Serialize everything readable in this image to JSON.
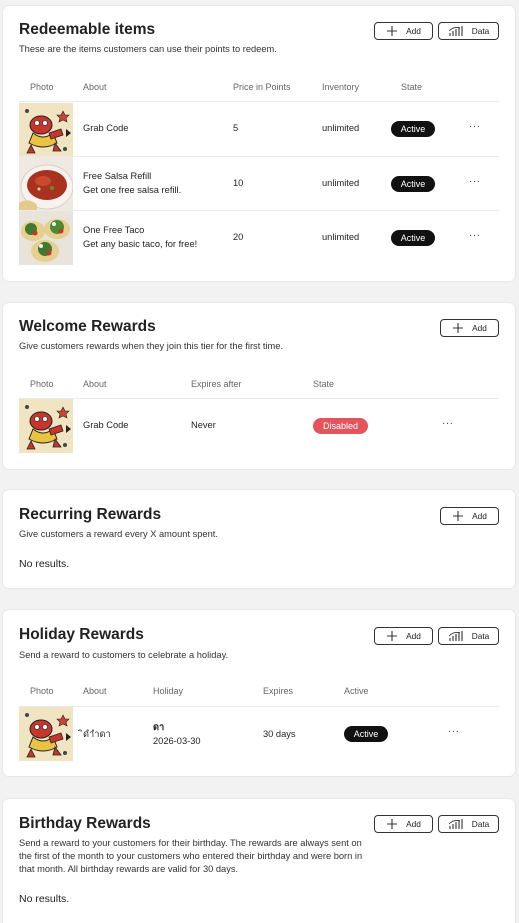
{
  "colors": {
    "active_badge": "#111111",
    "disabled_badge": "#e4545d",
    "page_bg": "#f2f2f3"
  },
  "redeemable": {
    "title": "Redeemable items",
    "description": "These are the items customers can use their points to redeem.",
    "add_label": "Add",
    "data_label": "Data",
    "columns": [
      "Photo",
      "About",
      "Price in Points",
      "Inventory",
      "State"
    ],
    "rows": [
      {
        "name": "Grab Code",
        "detail": "",
        "price": "5",
        "inventory": "unlimited",
        "state": "Active",
        "photo": "mascot-graphic"
      },
      {
        "name": "Free Salsa Refill",
        "detail": "Get one free salsa refill.",
        "price": "10",
        "inventory": "unlimited",
        "state": "Active",
        "photo": "salsa-bowl-photo"
      },
      {
        "name": "One Free Taco",
        "detail": "Get any basic taco, for free!",
        "price": "20",
        "inventory": "unlimited",
        "state": "Active",
        "photo": "tacos-photo"
      }
    ],
    "more": "···"
  },
  "welcome": {
    "title": "Welcome Rewards",
    "description": "Give customers rewards when they join this tier for the first time.",
    "add_label": "Add",
    "columns": [
      "Photo",
      "About",
      "Expires after",
      "State"
    ],
    "rows": [
      {
        "name": "Grab Code",
        "expires": "Never",
        "state": "Disabled",
        "photo": "mascot-graphic"
      }
    ],
    "more": "···"
  },
  "recurring": {
    "title": "Recurring Rewards",
    "description": "Give customers a reward every X amount spent.",
    "add_label": "Add",
    "empty": "No results."
  },
  "holiday": {
    "title": "Holiday Rewards",
    "description": "Send a reward to customers to celebrate a holiday.",
    "add_label": "Add",
    "data_label": "Data",
    "columns": [
      "Photo",
      "About",
      "Holiday",
      "Expires",
      "Active"
    ],
    "rows": [
      {
        "name": "ิดำำดา",
        "holiday_name": "ดา",
        "holiday_date": "2026-03-30",
        "expires": "30 days",
        "state": "Active",
        "photo": "mascot-graphic"
      }
    ],
    "more": "···"
  },
  "birthday": {
    "title": "Birthday Rewards",
    "description": "Send a reward to your customers for their birthday. The rewards are always sent on the first of the month to your customers who entered their birthday and were born in that month. All birthday rewards are valid for 30 days.",
    "add_label": "Add",
    "data_label": "Data",
    "empty": "No results."
  }
}
